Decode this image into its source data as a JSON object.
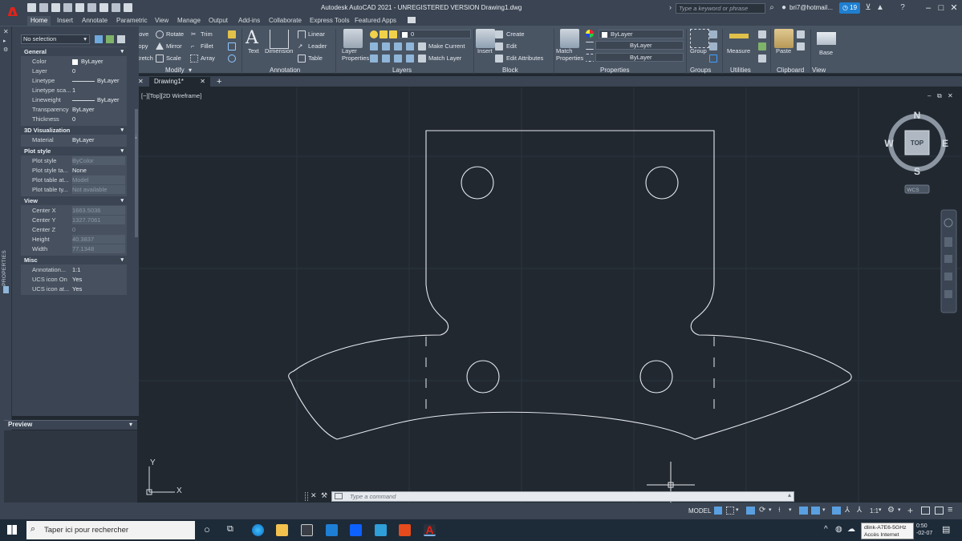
{
  "titlebar": {
    "app_title": "Autodesk AutoCAD 2021 - UNREGISTERED VERSION    Drawing1.dwg",
    "search_placeholder": "Type a keyword or phrase",
    "user_name": "bri7@hotmail...",
    "notification_count": "19"
  },
  "menu_tabs": [
    "Home",
    "Insert",
    "Annotate",
    "Parametric",
    "View",
    "Manage",
    "Output",
    "Add-ins",
    "Collaborate",
    "Express Tools",
    "Featured Apps"
  ],
  "active_tab": "Home",
  "ribbon": {
    "modify": {
      "title": "Modify",
      "move": "Move",
      "copy": "Copy",
      "stretch": "Stretch",
      "rotate": "Rotate",
      "mirror": "Mirror",
      "scale": "Scale",
      "trim": "Trim",
      "fillet": "Fillet",
      "array": "Array"
    },
    "annotation": {
      "title": "Annotation",
      "text": "Text",
      "dimension": "Dimension",
      "linear": "Linear",
      "leader": "Leader",
      "table": "Table"
    },
    "layers": {
      "title": "Layers",
      "layer_properties": "Layer Properties",
      "layer_value": "0",
      "make_current": "Make Current",
      "match_layer": "Match Layer"
    },
    "block": {
      "title": "Block",
      "insert": "Insert",
      "create": "Create",
      "edit": "Edit",
      "edit_attributes": "Edit Attributes"
    },
    "properties": {
      "title": "Properties",
      "match_properties": "Match Properties",
      "color": "ByLayer",
      "linetype": "ByLayer",
      "lineweight": "ByLayer"
    },
    "groups": {
      "title": "Groups",
      "group": "Group"
    },
    "utilities": {
      "title": "Utilities",
      "measure": "Measure"
    },
    "clipboard": {
      "title": "Clipboard",
      "paste": "Paste"
    },
    "view": {
      "title": "View",
      "base": "Base"
    }
  },
  "properties_panel": {
    "selection": "No selection",
    "vertical_label": "PROPERTIES",
    "sections": {
      "general": "General",
      "viz3d": "3D Visualization",
      "plot_style": "Plot style",
      "view": "View",
      "misc": "Misc"
    },
    "general": [
      {
        "k": "Color",
        "v": "ByLayer"
      },
      {
        "k": "Layer",
        "v": "0"
      },
      {
        "k": "Linetype",
        "v": "ByLayer"
      },
      {
        "k": "Linetype sca...",
        "v": "1"
      },
      {
        "k": "Lineweight",
        "v": "ByLayer"
      },
      {
        "k": "Transparency",
        "v": "ByLayer"
      },
      {
        "k": "Thickness",
        "v": "0"
      }
    ],
    "viz3d": [
      {
        "k": "Material",
        "v": "ByLayer"
      }
    ],
    "plot_style": [
      {
        "k": "Plot style",
        "v": "ByColor"
      },
      {
        "k": "Plot style ta...",
        "v": "None"
      },
      {
        "k": "Plot table at...",
        "v": "Model"
      },
      {
        "k": "Plot table ty...",
        "v": "Not available"
      }
    ],
    "view": [
      {
        "k": "Center X",
        "v": "1663.5036"
      },
      {
        "k": "Center Y",
        "v": "1327.7061"
      },
      {
        "k": "Center Z",
        "v": "0"
      },
      {
        "k": "Height",
        "v": "40.3837"
      },
      {
        "k": "Width",
        "v": "77.1348"
      }
    ],
    "misc": [
      {
        "k": "Annotation...",
        "v": "1:1"
      },
      {
        "k": "UCS icon On",
        "v": "Yes"
      },
      {
        "k": "UCS icon at...",
        "v": "Yes"
      }
    ],
    "preview_title": "Preview"
  },
  "document_tabs": {
    "active": "Drawing1*"
  },
  "viewport": {
    "label": "[−][Top][2D Wireframe]",
    "viewcube": {
      "north": "N",
      "south": "S",
      "east": "E",
      "west": "W",
      "face": "TOP",
      "ucs": "WCS"
    },
    "ucs_x": "X",
    "ucs_y": "Y"
  },
  "command_line": {
    "placeholder": "Type a command"
  },
  "statusbar": {
    "model": "MODEL",
    "scale": "1:1"
  },
  "taskbar": {
    "search_placeholder": "Taper ici pour rechercher",
    "tooltip_line1": "dlink-A7E6-5GHz",
    "tooltip_line2": "Accès Internet",
    "clock_time": "0:50",
    "clock_date": "-02-07"
  },
  "colors": {
    "canvas": "#212830",
    "ribbon": "#4a5564",
    "accent": "#1f7fd0",
    "autocad_red": "#e2231a"
  }
}
